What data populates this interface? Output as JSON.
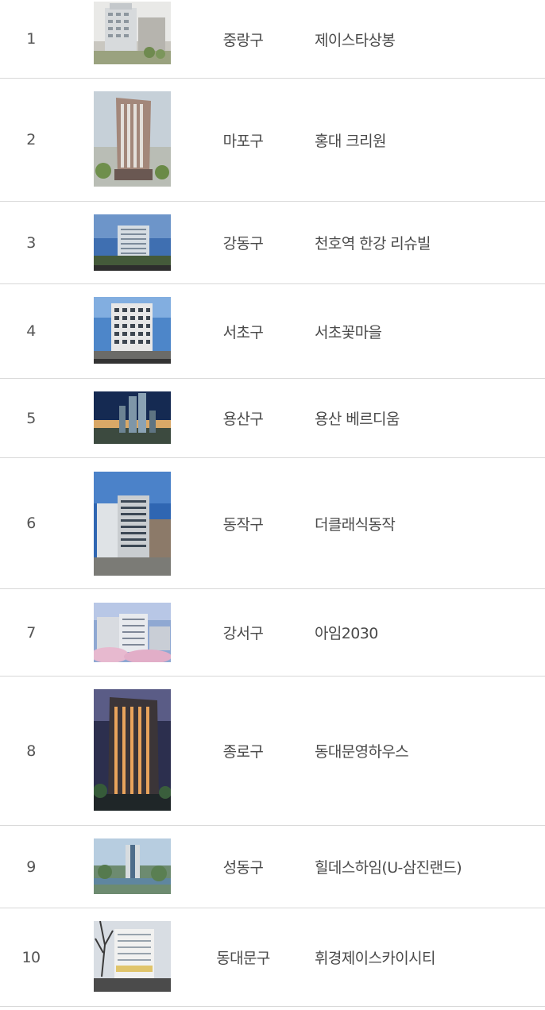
{
  "rows": [
    {
      "num": "1",
      "district": "중랑구",
      "name": "제이스타상봉",
      "image": "building-photo"
    },
    {
      "num": "2",
      "district": "마포구",
      "name": "홍대 크리원",
      "image": "building-photo"
    },
    {
      "num": "3",
      "district": "강동구",
      "name": "천호역 한강 리슈빌",
      "image": "building-photo"
    },
    {
      "num": "4",
      "district": "서초구",
      "name": "서초꽃마을",
      "image": "building-photo"
    },
    {
      "num": "5",
      "district": "용산구",
      "name": "용산 베르디움",
      "image": "building-photo"
    },
    {
      "num": "6",
      "district": "동작구",
      "name": "더클래식동작",
      "image": "building-photo"
    },
    {
      "num": "7",
      "district": "강서구",
      "name": "아임2030",
      "image": "building-photo"
    },
    {
      "num": "8",
      "district": "종로구",
      "name": "동대문영하우스",
      "image": "building-photo"
    },
    {
      "num": "9",
      "district": "성동구",
      "name": "힐데스하임(U-삼진랜드)",
      "image": "building-photo"
    },
    {
      "num": "10",
      "district": "동대문구",
      "name": "휘경제이스카이시티",
      "image": "building-photo"
    }
  ]
}
